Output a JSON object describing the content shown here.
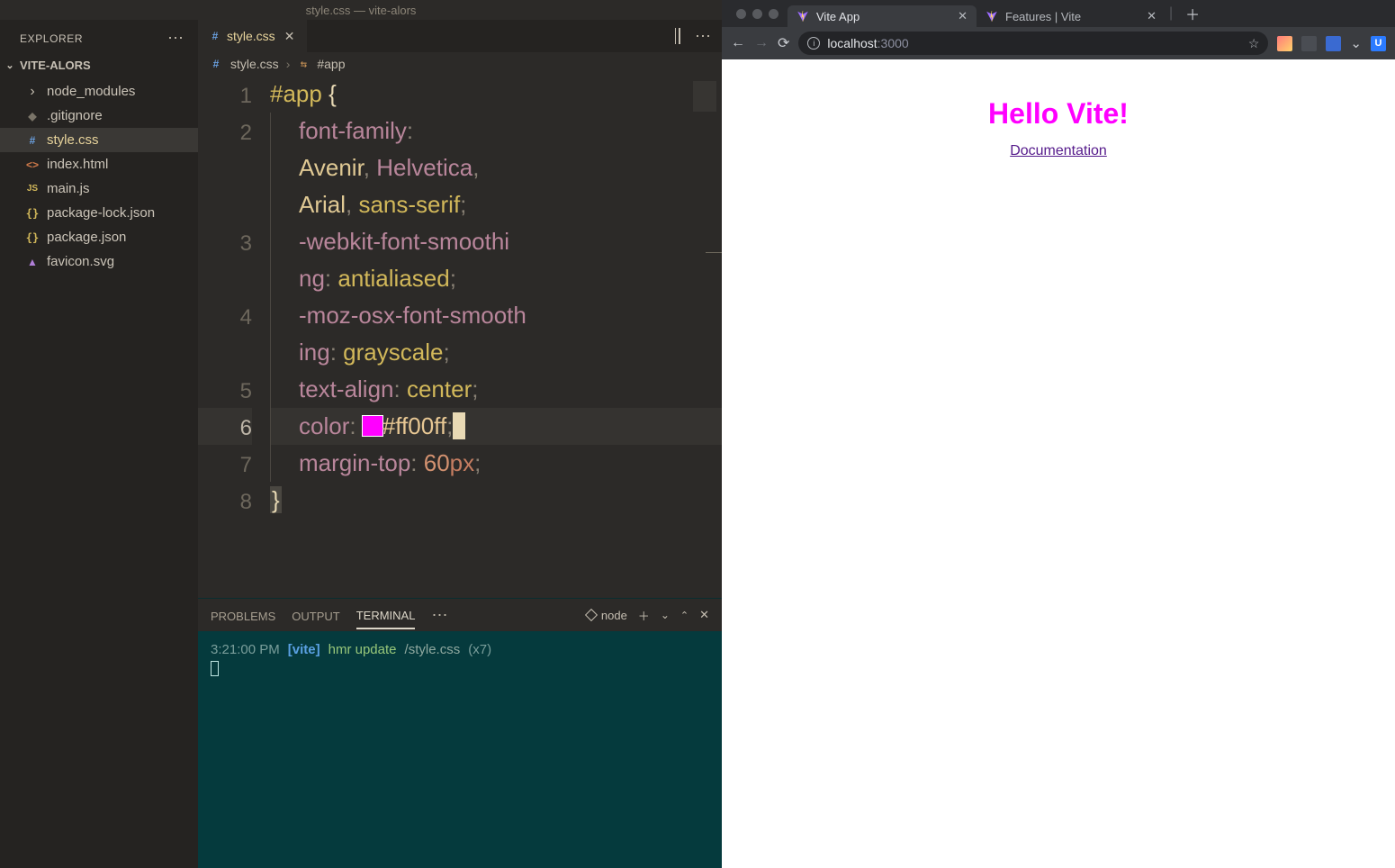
{
  "vscode": {
    "window_title": "style.css — vite-alors",
    "explorer": {
      "title": "EXPLORER",
      "project": "VITE-ALORS",
      "files": [
        {
          "name": "node_modules",
          "icon": "chev",
          "interactable": true
        },
        {
          "name": ".gitignore",
          "icon": "git",
          "interactable": true
        },
        {
          "name": "style.css",
          "icon": "css",
          "interactable": true,
          "active": true
        },
        {
          "name": "index.html",
          "icon": "html",
          "interactable": true
        },
        {
          "name": "main.js",
          "icon": "js",
          "interactable": true
        },
        {
          "name": "package-lock.json",
          "icon": "json",
          "interactable": true
        },
        {
          "name": "package.json",
          "icon": "json",
          "interactable": true
        },
        {
          "name": "favicon.svg",
          "icon": "svg",
          "interactable": true
        }
      ]
    },
    "tab": {
      "name": "style.css"
    },
    "breadcrumbs": {
      "file": "style.css",
      "symbol": "#app"
    },
    "code": {
      "lines": [
        1,
        2,
        3,
        4,
        5,
        6,
        7,
        8
      ],
      "l1": {
        "sel": "#app",
        "brace": "{"
      },
      "l2": {
        "prop": "font-family",
        "colon": ":",
        "v1": "Avenir",
        "v2": "Helvetica",
        "v3": "Arial",
        "v4": "sans-serif",
        "comma": ", ",
        "semi": ";"
      },
      "l3": {
        "prop_a": "-webkit-font-smoothi",
        "prop_b": "ng",
        "colon": ":",
        "val": "antialiased",
        "semi": ";"
      },
      "l4": {
        "prop_a": "-moz-osx-font-smooth",
        "prop_b": "ing",
        "colon": ":",
        "val": "grayscale",
        "semi": ";"
      },
      "l5": {
        "prop": "text-align",
        "colon": ":",
        "val": "center",
        "semi": ";"
      },
      "l6": {
        "prop": "color",
        "colon": ":",
        "hex": "#ff00ff",
        "semi": ";"
      },
      "l7": {
        "prop": "margin-top",
        "colon": ":",
        "num": "60",
        "unit": "px",
        "semi": ";"
      },
      "l8": {
        "brace": "}"
      }
    },
    "panel": {
      "tabs": {
        "problems": "PROBLEMS",
        "output": "OUTPUT",
        "terminal": "TERMINAL"
      },
      "task": "node",
      "terminal": {
        "time": "3:21:00 PM",
        "tag": "[vite]",
        "msg": "hmr update",
        "path": "/style.css",
        "count": "(x7)"
      }
    }
  },
  "browser": {
    "tabs": [
      {
        "title": "Vite App",
        "active": true
      },
      {
        "title": "Features | Vite",
        "active": false
      }
    ],
    "url": {
      "host": "localhost",
      "port": ":3000"
    },
    "page": {
      "h1": "Hello Vite!",
      "link": "Documentation"
    }
  }
}
